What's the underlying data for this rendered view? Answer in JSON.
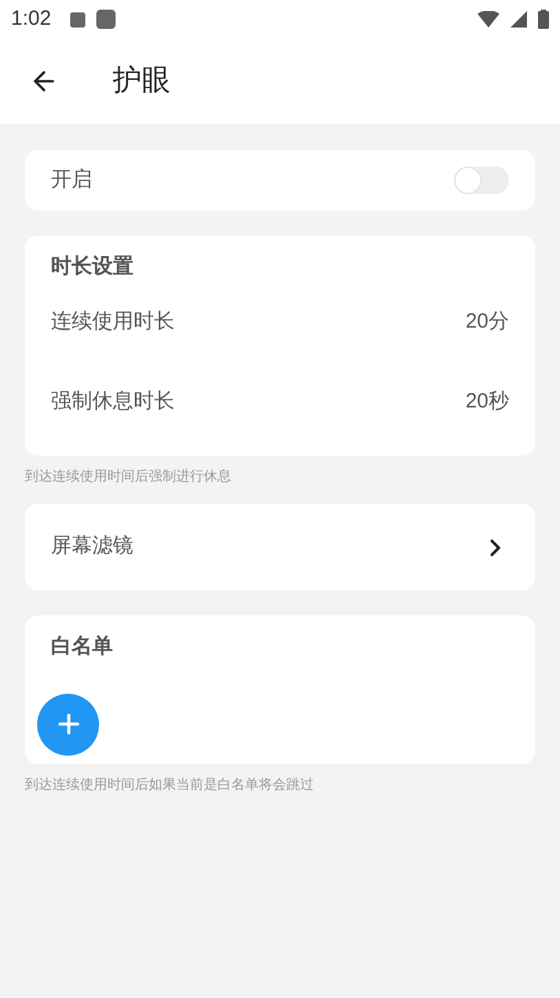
{
  "status_bar": {
    "time": "1:02"
  },
  "app_bar": {
    "title": "护眼"
  },
  "enable": {
    "label": "开启",
    "on": false
  },
  "duration": {
    "title": "时长设置",
    "rows": [
      {
        "label": "连续使用时长",
        "value": "20分"
      },
      {
        "label": "强制休息时长",
        "value": "20秒"
      }
    ],
    "hint": "到达连续使用时间后强制进行休息"
  },
  "filter": {
    "label": "屏幕滤镜"
  },
  "whitelist": {
    "title": "白名单",
    "hint": "到达连续使用时间后如果当前是白名单将会跳过"
  }
}
